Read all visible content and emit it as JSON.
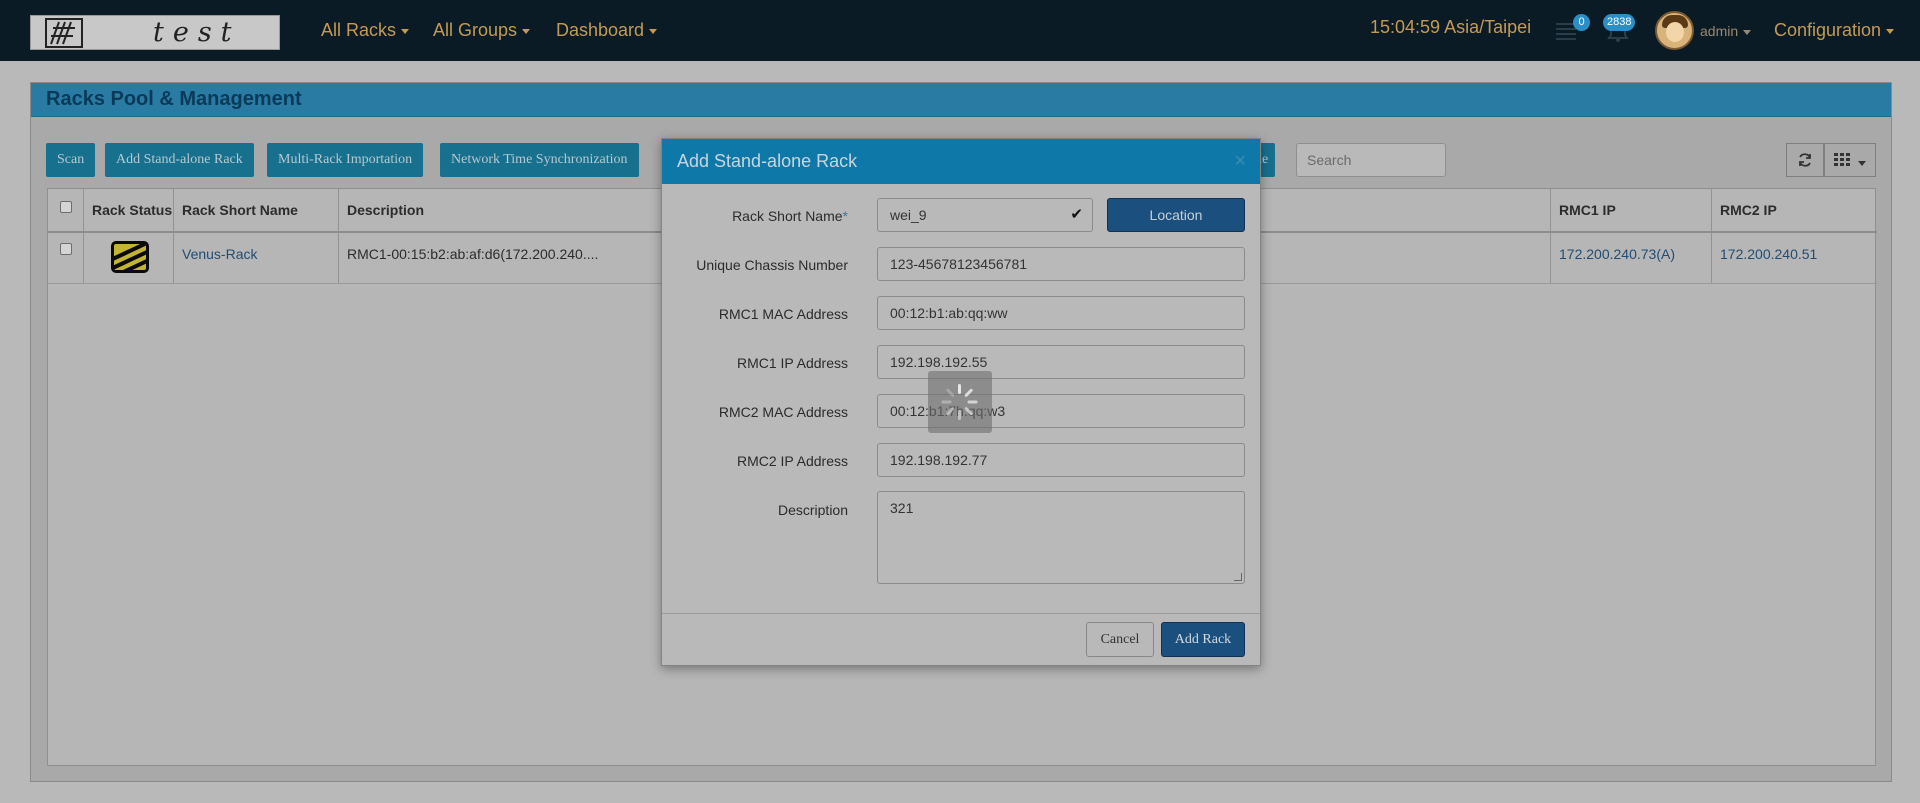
{
  "app": {
    "logo_text": "test",
    "nav_menus": [
      "All Racks",
      "All Groups",
      "Dashboard"
    ],
    "time": "15:04:59 Asia/Taipei",
    "notifications": [
      {
        "icon": "list-icon",
        "count": "0"
      },
      {
        "icon": "bell-icon",
        "count": "2838"
      }
    ],
    "user": "admin",
    "configuration": "Configuration"
  },
  "panel": {
    "title": "Racks Pool & Management",
    "toolbar": [
      "Scan",
      "Add Stand-alone Rack",
      "Multi-Rack Importation",
      "Network Time Synchronization"
    ],
    "hidden_button_fragment": "de",
    "search_placeholder": "Search",
    "refresh_icon": "refresh-icon",
    "columns_icon": "grid-icon"
  },
  "table": {
    "columns": [
      "Rack Status",
      "Rack Short Name",
      "Description",
      "RMC1 IP",
      "RMC2 IP"
    ],
    "rows": [
      {
        "status_icon": "rack-status-icon",
        "name": "Venus-Rack",
        "description": "RMC1-00:15:b2:ab:af:d6(172.200.240....",
        "rmc1_ip": "172.200.240.73(A)",
        "rmc2_ip": "172.200.240.51"
      }
    ]
  },
  "modal": {
    "title": "Add Stand-alone Rack",
    "close": "×",
    "fields": {
      "rack_short_name": {
        "label": "Rack Short Name",
        "required_mark": "*",
        "value": "wei_9"
      },
      "unique_chassis_number": {
        "label": "Unique Chassis Number",
        "value": "123-45678123456781"
      },
      "rmc1_mac": {
        "label": "RMC1 MAC Address",
        "value": "00:12:b1:ab:qq:ww"
      },
      "rmc1_ip": {
        "label": "RMC1 IP Address",
        "value": "192.198.192.55"
      },
      "rmc2_mac": {
        "label": "RMC2 MAC Address",
        "value": "00:12:b1:7h:qq:w3"
      },
      "rmc2_ip": {
        "label": "RMC2 IP Address",
        "value": "192.198.192.77"
      },
      "description": {
        "label": "Description",
        "value": "321"
      }
    },
    "location_button": "Location",
    "cancel_button": "Cancel",
    "add_button": "Add Rack"
  },
  "colors": {
    "navbar": "#0b1b25",
    "accent_gold": "#c49a55",
    "modal_header": "#0e78a8",
    "primary_button": "#1b4f7e",
    "toolbar_button": "#16708e",
    "link": "#204d75"
  }
}
